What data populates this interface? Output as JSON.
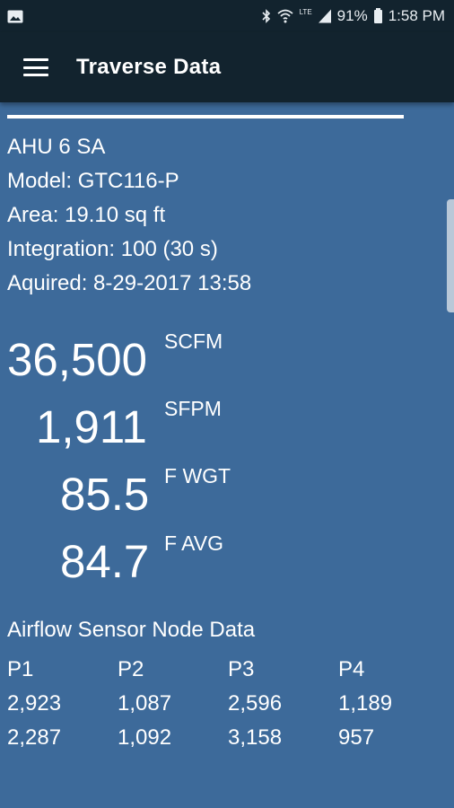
{
  "status_bar": {
    "battery": "91%",
    "time": "1:58 PM",
    "icons": [
      "image-icon",
      "bluetooth-icon",
      "wifi-icon",
      "lte-signal-icon",
      "battery-icon"
    ]
  },
  "app_bar": {
    "title": "Traverse Data"
  },
  "info": {
    "name": "AHU 6 SA",
    "model": "Model: GTC116-P",
    "area": "Area: 19.10 sq ft",
    "integration": "Integration: 100 (30 s)",
    "acquired": "Aquired: 8-29-2017 13:58"
  },
  "metrics": [
    {
      "value": "36,500",
      "unit": "SCFM"
    },
    {
      "value": "1,911",
      "unit": "SFPM"
    },
    {
      "value": "85.5",
      "unit": "F WGT"
    },
    {
      "value": "84.7",
      "unit": "F AVG"
    }
  ],
  "sensor_nodes": {
    "title": "Airflow Sensor Node Data",
    "headers": [
      "P1",
      "P2",
      "P3",
      "P4"
    ],
    "rows": [
      [
        "2,923",
        "1,087",
        "2,596",
        "1,189"
      ],
      [
        "2,287",
        "1,092",
        "3,158",
        "957"
      ]
    ]
  },
  "colors": {
    "background": "#3d6a9a",
    "app_bar": "#12232e",
    "text": "#ffffff"
  }
}
